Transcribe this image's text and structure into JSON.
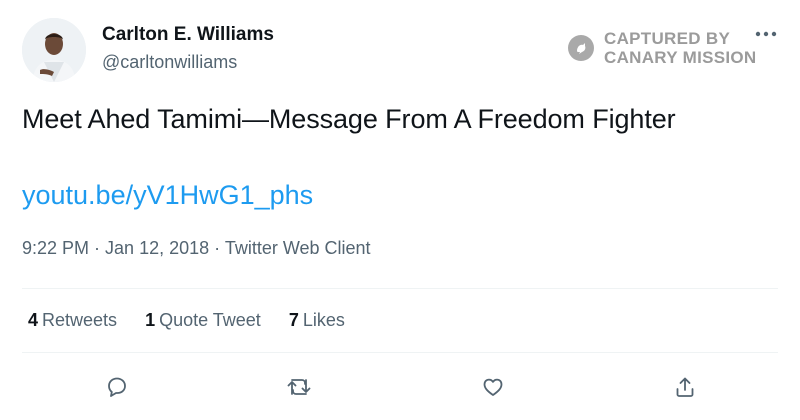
{
  "author": {
    "display_name": "Carlton E. Williams",
    "handle": "@carltonwilliams"
  },
  "watermark": {
    "line1": "CAPTURED BY",
    "line2": "CANARY MISSION"
  },
  "tweet": {
    "text": "Meet Ahed Tamimi—Message From A Freedom Fighter",
    "link": "youtu.be/yV1HwG1_phs"
  },
  "meta": {
    "time": "9:22 PM",
    "separator": " · ",
    "date": "Jan 12, 2018",
    "client": "Twitter Web Client"
  },
  "stats": {
    "retweets_count": "4",
    "retweets_label": "Retweets",
    "quotes_count": "1",
    "quotes_label": "Quote Tweet",
    "likes_count": "7",
    "likes_label": "Likes"
  },
  "icons": {
    "more": "more-icon",
    "reply": "reply-icon",
    "retweet": "retweet-icon",
    "like": "like-icon",
    "share": "share-icon"
  },
  "colors": {
    "link": "#1d9bf0",
    "secondary_text": "#536471",
    "primary_text": "#0f1419",
    "watermark": "#9b9b9b"
  }
}
